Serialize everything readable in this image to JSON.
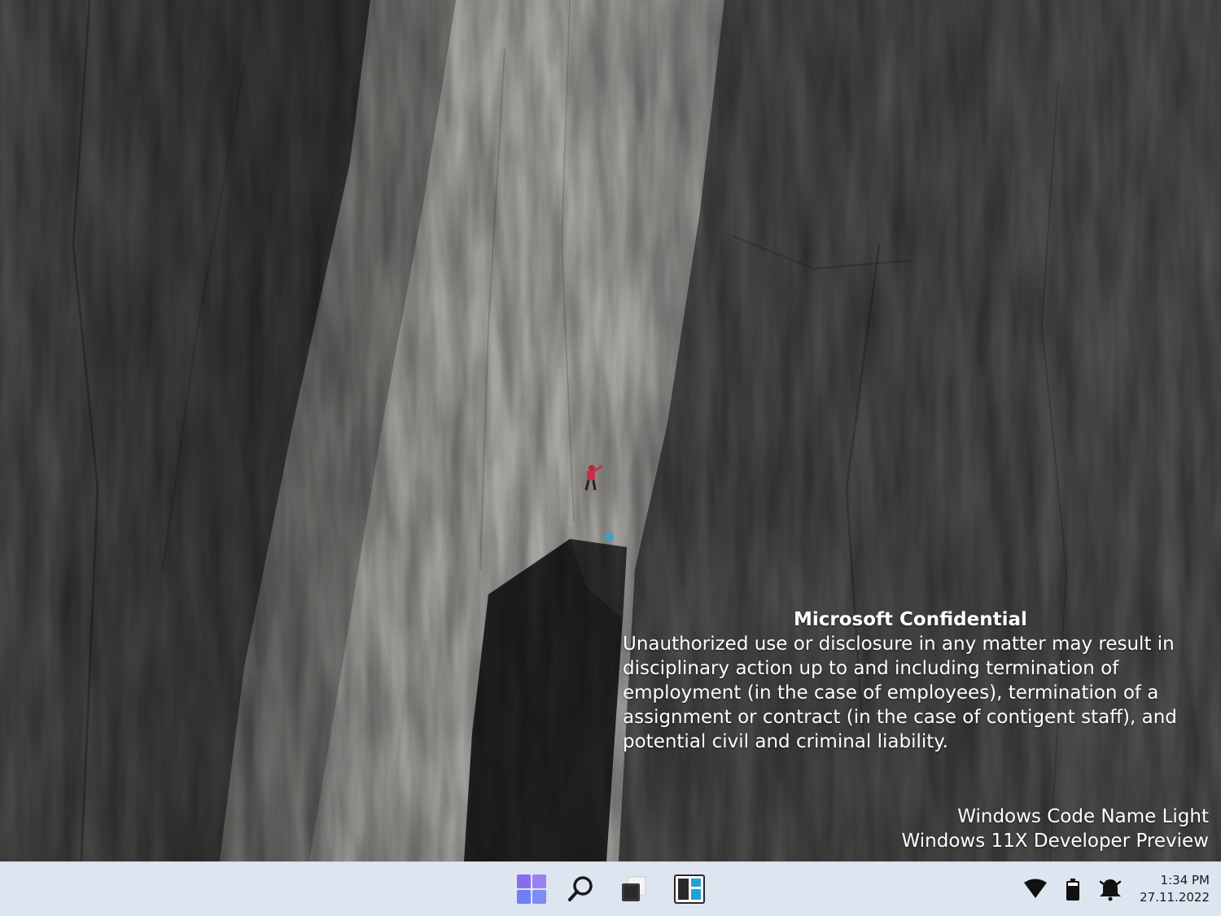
{
  "watermark": {
    "title": "Microsoft Confidential",
    "body": "Unauthorized use or disclosure in any matter may result in disciplinary action up to and including termination of employment (in the case of employees), termination of a assignment or contract (in the case of contigent staff), and potential civil and criminal liability."
  },
  "build_info": {
    "line1": "Windows Code Name Light",
    "line2": "Windows 11X Developer Preview"
  },
  "taskbar": {
    "pinned": [
      {
        "name": "start-button",
        "icon": "windows-logo-icon"
      },
      {
        "name": "search-button",
        "icon": "search-icon"
      },
      {
        "name": "task-view-button",
        "icon": "task-view-icon"
      },
      {
        "name": "widgets-button",
        "icon": "widgets-icon"
      }
    ],
    "tray": {
      "icons": [
        "wifi-icon",
        "battery-icon",
        "notification-bell-icon"
      ],
      "time": "1:34 PM",
      "date": "27.11.2022"
    }
  },
  "colors": {
    "taskbar_bg": "#dde6f0",
    "start_accent": "#8b6cf0",
    "widgets_accent": "#1fa3d6"
  }
}
